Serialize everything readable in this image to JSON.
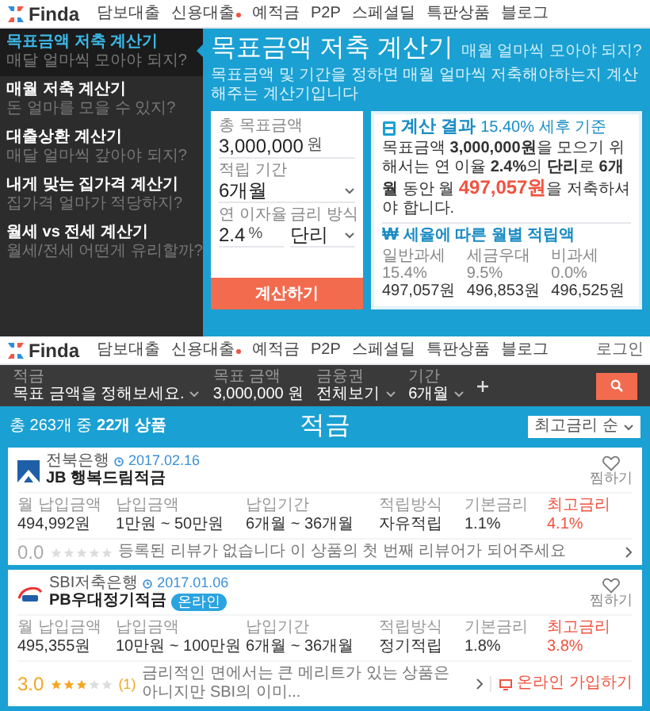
{
  "top_nav": {
    "logo": "Finda",
    "items": [
      {
        "label": "담보대출",
        "dot": false
      },
      {
        "label": "신용대출",
        "dot": true
      },
      {
        "label": "예적금",
        "dot": false
      },
      {
        "label": "P2P",
        "dot": false
      },
      {
        "label": "스페셜딜",
        "dot": false
      },
      {
        "label": "특판상품",
        "dot": false
      },
      {
        "label": "블로그",
        "dot": false
      }
    ]
  },
  "sidebar": {
    "items": [
      {
        "title": "목표금액 저축 계산기",
        "subtitle": "매달 얼마씩 모아야 되지?",
        "selected": true
      },
      {
        "title": "매월 저축 계산기",
        "subtitle": "돈 얼마를 모을 수 있지?",
        "selected": false
      },
      {
        "title": "대출상환 계산기",
        "subtitle": "매달 얼마씩 갚아야 되지?",
        "selected": false
      },
      {
        "title": "내게 맞는 집가격 계산기",
        "subtitle": "집가격 얼마가 적당하지?",
        "selected": false
      },
      {
        "title": "월세 vs 전세 계산기",
        "subtitle": "월세/전세 어떤게 유리할까?",
        "selected": false
      }
    ]
  },
  "calculator": {
    "title": "목표금액 저축 계산기",
    "subtitle": "매월 얼마씩 모아야 되지?",
    "description": "목표금액 및 기간을 정하면 매월 얼마씩 저축해야하는지 계산해주는 계산기입니다",
    "fields": [
      {
        "label": "총 목표금액",
        "value": "3,000,000",
        "unit": "원",
        "kind": "input"
      },
      {
        "label": "적립 기간",
        "value": "6개월",
        "kind": "select"
      },
      {
        "label": "연 이자율",
        "value": "2.4",
        "unit": "%",
        "kind": "input"
      },
      {
        "label": "금리 방식",
        "value": "단리",
        "kind": "select"
      }
    ],
    "button": "계산하기"
  },
  "result": {
    "title": "계산 결과",
    "basis": "15.40% 세후 기준",
    "before": "목표금액 **3,000,000원**을 모으기 위해서는 연 이율 **2.4%**의 **단리**로 **6개월** 동안 월 ",
    "highlight": "497,057원",
    "after": "을 저축하셔야 합니다.",
    "tax": {
      "icon": "₩",
      "title": "세율에 따른 월별 적립액",
      "items": [
        {
          "label": "일반과세 15.4%",
          "value": "497,057원"
        },
        {
          "label": "세금우대 9.5%",
          "value": "496,853원"
        },
        {
          "label": "비과세 0.0%",
          "value": "496,525원"
        }
      ]
    }
  },
  "second_nav": {
    "logo": "Finda",
    "items": [
      {
        "label": "담보대출",
        "dot": false
      },
      {
        "label": "신용대출",
        "dot": true
      },
      {
        "label": "예적금",
        "dot": false
      },
      {
        "label": "P2P",
        "dot": false
      },
      {
        "label": "스페셜딜",
        "dot": false
      },
      {
        "label": "특판상품",
        "dot": false
      },
      {
        "label": "블로그",
        "dot": false
      }
    ],
    "login": "로그인"
  },
  "search_bar": {
    "fields": [
      {
        "label": "적금",
        "value": "목표 금액을 정해보세요.",
        "kind": "select"
      },
      {
        "label": "목표 금액",
        "value": "3,000,000 원",
        "kind": "input"
      },
      {
        "label": "금융권",
        "value": "전체보기",
        "kind": "select"
      },
      {
        "label": "기간",
        "value": "6개월",
        "kind": "select"
      }
    ]
  },
  "products": {
    "summary": "총 263개 중 **22개 상품**",
    "title": "적금",
    "sort": "최고금리 순",
    "cards": [
      {
        "bank": "전북은행",
        "date": "2017.02.16",
        "name": "JB 행복드림적금",
        "favorite": "찜하기",
        "fields": [
          {
            "label": "월 납입금액",
            "value": "494,992원",
            "highlight": false
          },
          {
            "label": "납입금액",
            "value": "1만원 ~ 50만원",
            "highlight": false
          },
          {
            "label": "납입기간",
            "value": "6개월 ~ 36개월",
            "highlight": false
          },
          {
            "label": "적립방식",
            "value": "자유적립",
            "highlight": false
          },
          {
            "label": "기본금리",
            "value": "1.1%",
            "highlight": false
          },
          {
            "label": "최고금리",
            "value": "4.1%",
            "highlight": true
          }
        ],
        "rating": "0.0",
        "stars": 0,
        "review": "등록된 리뷰가 없습니다 이 상품의 첫 번째 리뷰어가 되어주세요"
      },
      {
        "bank": "SBI저축은행",
        "date": "2017.01.06",
        "name": "PB우대정기적금",
        "badge": "온라인",
        "favorite": "찜하기",
        "fields": [
          {
            "label": "월 납입금액",
            "value": "495,355원",
            "highlight": false
          },
          {
            "label": "납입금액",
            "value": "10만원 ~ 100만원",
            "highlight": false
          },
          {
            "label": "납입기간",
            "value": "6개월 ~ 36개월",
            "highlight": false
          },
          {
            "label": "적립방식",
            "value": "정기적립",
            "highlight": false
          },
          {
            "label": "기본금리",
            "value": "1.8%",
            "highlight": false
          },
          {
            "label": "최고금리",
            "value": "3.8%",
            "highlight": true
          }
        ],
        "rating": "3.0",
        "stars": 3,
        "count": "(1)",
        "review": "금리적인 면에서는 큰 메리트가 있는 상품은 아니지만 SBI의 이미...",
        "cta": "온라인 가입하기"
      }
    ]
  }
}
